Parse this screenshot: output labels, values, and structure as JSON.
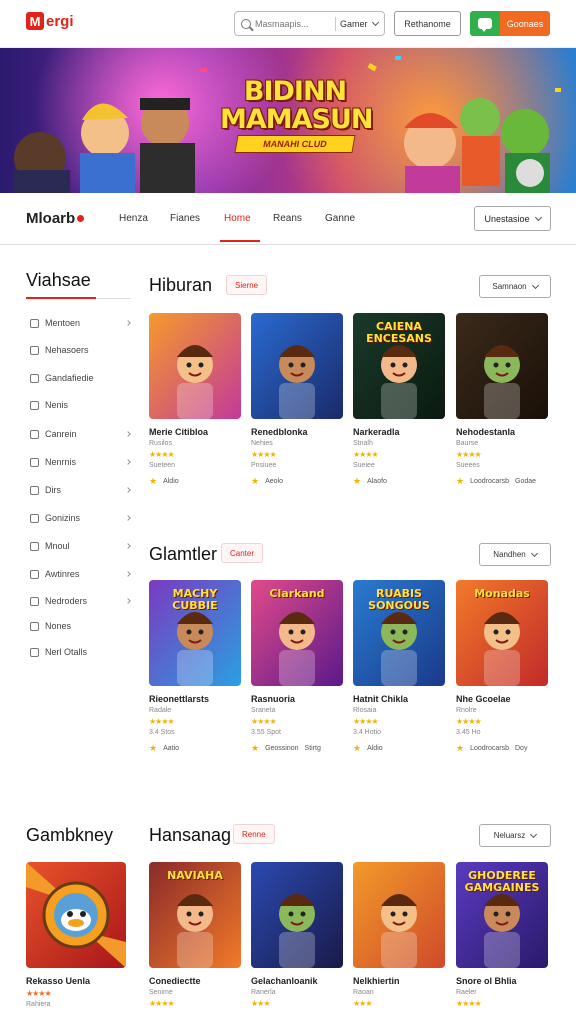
{
  "header": {
    "logo_mark": "M",
    "logo_text": "ergi",
    "search_placeholder": "Masmaapis...",
    "search_button": "Gamer",
    "outline_button": "Rethanome",
    "orange_button": "Goonaes"
  },
  "banner": {
    "title_line1": "BIDINN",
    "title_line2": "MAMASUN",
    "subtitle": "MANAHI CLUD"
  },
  "subnav": {
    "brand": "Mloarb",
    "links": [
      "Henza",
      "Fianes",
      "Home",
      "Reans",
      "Ganne"
    ],
    "active_index": 2,
    "select_label": "Unestasioe"
  },
  "sidebar": {
    "title": "Viahsae",
    "items": [
      {
        "label": "Mentoen",
        "arrow": true
      },
      {
        "label": "Nehasoers",
        "arrow": false
      },
      {
        "label": "Gandafiedie",
        "arrow": false
      },
      {
        "label": "Nenis",
        "arrow": false
      },
      {
        "label": "Canrein",
        "arrow": true
      },
      {
        "label": "Nenrnis",
        "arrow": true
      },
      {
        "label": "Dirs",
        "arrow": true
      },
      {
        "label": "Gonizins",
        "arrow": true
      },
      {
        "label": "Mnoul",
        "arrow": true
      },
      {
        "label": "Awtinres",
        "arrow": true
      },
      {
        "label": "Nedroders",
        "arrow": true
      },
      {
        "label": "Nones",
        "arrow": false
      },
      {
        "label": "Nerl Otalls",
        "arrow": false
      }
    ]
  },
  "sections": [
    {
      "title": "Hiburan",
      "badge": "Sierne",
      "select": "Samnaon",
      "cards": [
        {
          "title": "Merie Citibloa",
          "meta": "Rusilos",
          "stars": "★★★★",
          "meta2": "Sueteen",
          "foot": "Aldio",
          "foot2": ""
        },
        {
          "title": "Renedblonka",
          "meta": "Nehies",
          "stars": "★★★★",
          "meta2": "Pnsiuee",
          "foot": "Aeolo",
          "foot2": ""
        },
        {
          "title": "Narkeradla",
          "meta": "Stnalh",
          "stars": "★★★★",
          "meta2": "Sueiee",
          "foot": "Alaofo",
          "foot2": ""
        },
        {
          "title": "Nehodestanla",
          "meta": "Baurse",
          "stars": "★★★★",
          "meta2": "Sueees",
          "foot": "Loodrocarsb",
          "foot2": "Godae"
        }
      ],
      "thumb_text": [
        "",
        "",
        "CAIENA ENCESANS",
        ""
      ]
    },
    {
      "title": "Glamtler",
      "badge": "Canter",
      "select": "Nandhen",
      "cards": [
        {
          "title": "Rieonettlarsts",
          "meta": "Radale",
          "stars": "★★★★",
          "meta2": "3.4 Stos",
          "foot": "Aatio",
          "foot2": ""
        },
        {
          "title": "Rasnuoria",
          "meta": "Sraneta",
          "stars": "★★★★",
          "meta2": "3.55 Spot",
          "foot": "Geossinon",
          "foot2": "Stirtg"
        },
        {
          "title": "Hatnit Chikla",
          "meta": "Rlosaia",
          "stars": "★★★★",
          "meta2": "3.4 Hotio",
          "foot": "Aldio",
          "foot2": ""
        },
        {
          "title": "Nhe Gcoelae",
          "meta": "Rnolre",
          "stars": "★★★★",
          "meta2": "3.45 Ho",
          "foot": "Loodrocarsb",
          "foot2": "Doy"
        }
      ],
      "thumb_text": [
        "MACHY CUBBIE",
        "Clarkand",
        "RUABIS SONGOUS",
        "Monadas"
      ]
    },
    {
      "title": "Hansanag",
      "badge": "Renne",
      "select": "Neluarsz",
      "side_title": "Gambkney",
      "side_card": {
        "title": "Rekasso Uenla",
        "stars": "★★★★",
        "meta": "Rahiera"
      },
      "cards": [
        {
          "title": "Conediectte",
          "meta": "Senime",
          "stars": "★★★★",
          "meta2": "",
          "foot": "",
          "foot2": ""
        },
        {
          "title": "Gelachanloanik",
          "meta": "Ranerla",
          "stars": "★★★",
          "meta2": "",
          "foot": "",
          "foot2": ""
        },
        {
          "title": "Nelkhiertin",
          "meta": "Raoan",
          "stars": "★★★",
          "meta2": "",
          "foot": "",
          "foot2": ""
        },
        {
          "title": "Snore ol Bhlia",
          "meta": "Raeler",
          "stars": "★★★★",
          "meta2": "",
          "foot": "",
          "foot2": ""
        }
      ],
      "thumb_text": [
        "NAVIAHA",
        "",
        "",
        "GHODEREE GAMGAINES"
      ]
    }
  ],
  "colors": {
    "accent": "#e2231a",
    "green": "#2fb04a",
    "orange": "#f26a21",
    "star": "#f2b300"
  }
}
